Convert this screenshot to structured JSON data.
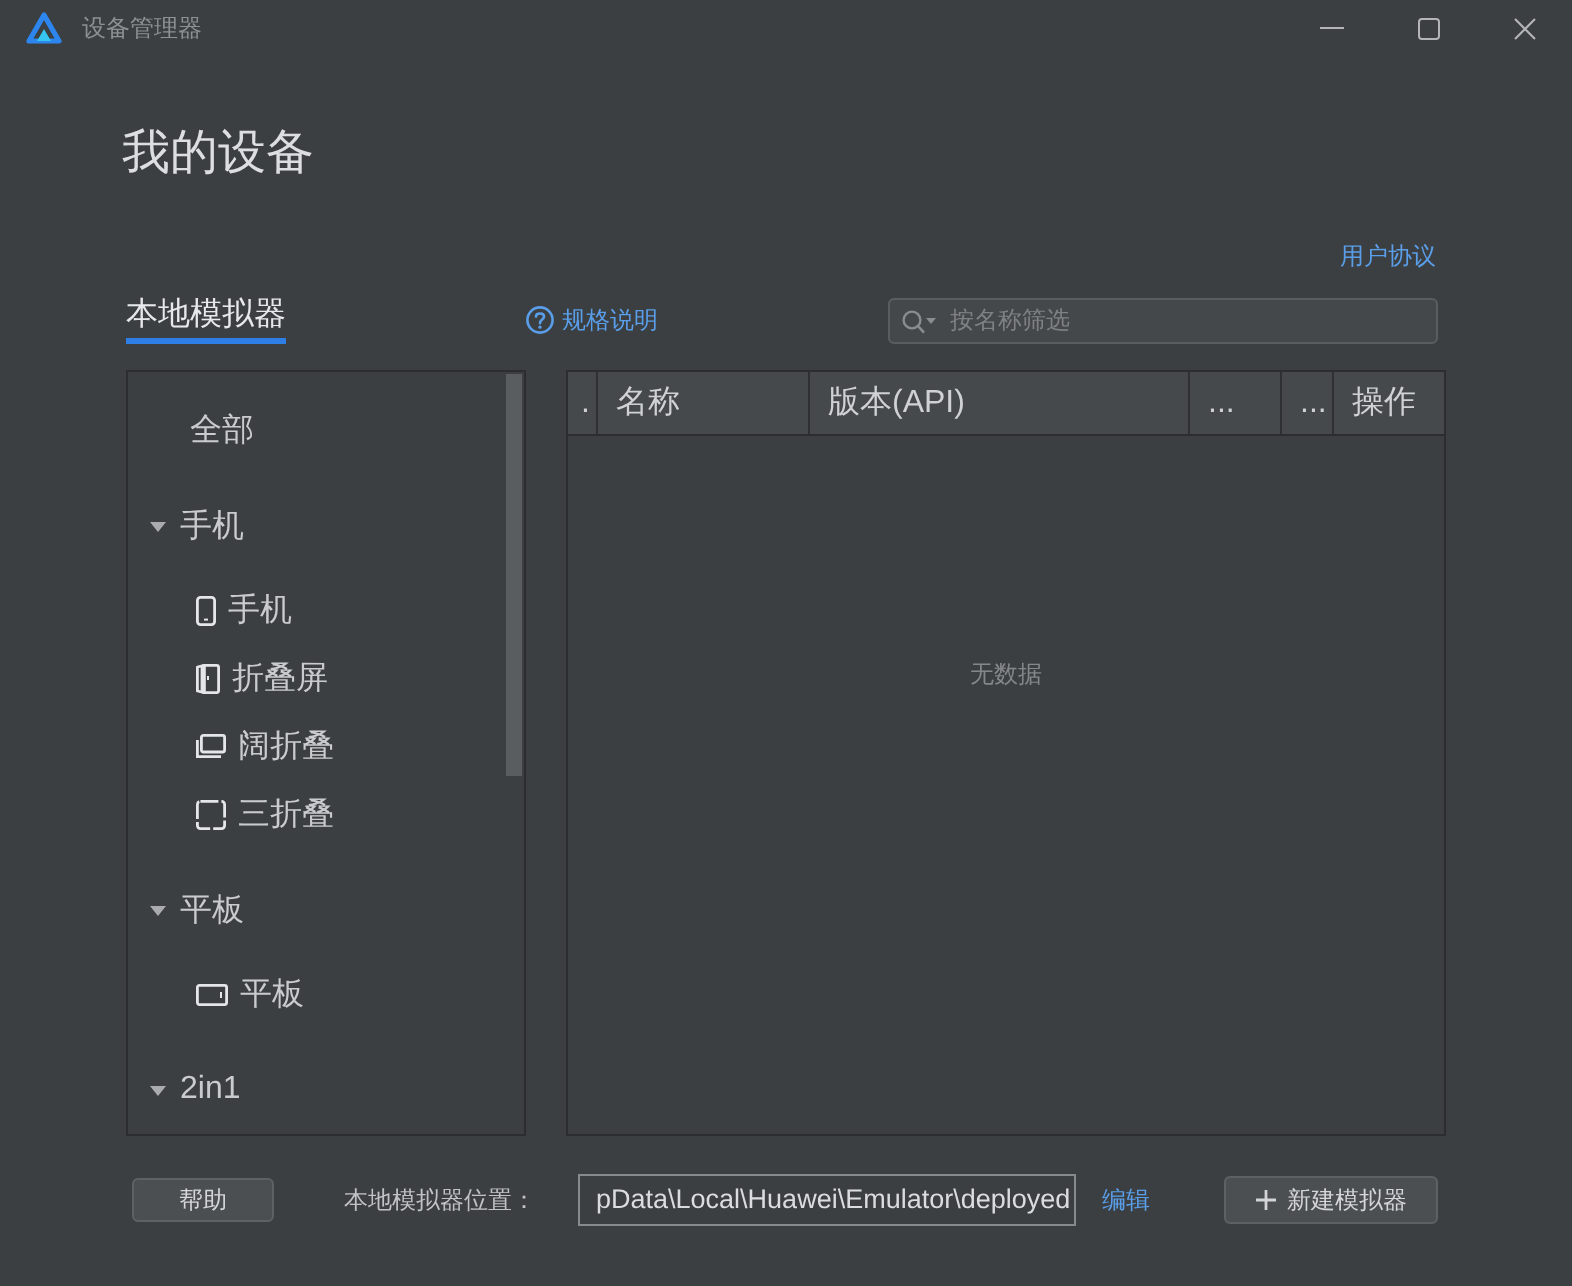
{
  "window": {
    "title": "设备管理器"
  },
  "page_title": "我的设备",
  "user_agreement_link": "用户协议",
  "tabs": [
    {
      "label": "本地模拟器",
      "selected": true
    }
  ],
  "spec_link": "规格说明",
  "search": {
    "placeholder": "按名称筛选"
  },
  "device_tree": {
    "items": [
      {
        "label": "全部",
        "kind": "all",
        "selected": false
      },
      {
        "label": "手机",
        "kind": "group",
        "expanded": true,
        "children": [
          {
            "label": "手机",
            "kind": "phone",
            "selected": false
          },
          {
            "label": "折叠屏",
            "kind": "foldable",
            "selected": false
          },
          {
            "label": "阔折叠",
            "kind": "wide-fold",
            "selected": false
          },
          {
            "label": "三折叠",
            "kind": "tri-fold",
            "selected": false
          }
        ]
      },
      {
        "label": "平板",
        "kind": "group",
        "expanded": true,
        "children": [
          {
            "label": "平板",
            "kind": "tablet",
            "selected": false
          }
        ]
      },
      {
        "label": "2in1",
        "kind": "group",
        "expanded": true
      }
    ]
  },
  "table": {
    "columns": [
      ".",
      "名称",
      "版本(API)",
      "...",
      "...",
      "操作"
    ],
    "empty_text": "无数据"
  },
  "footer": {
    "help_button": "帮助",
    "location_label": "本地模拟器位置：",
    "location_path": "pData\\Local\\Huawei\\Emulator\\deployed",
    "edit_link": "编辑",
    "new_button": "新建模拟器"
  }
}
